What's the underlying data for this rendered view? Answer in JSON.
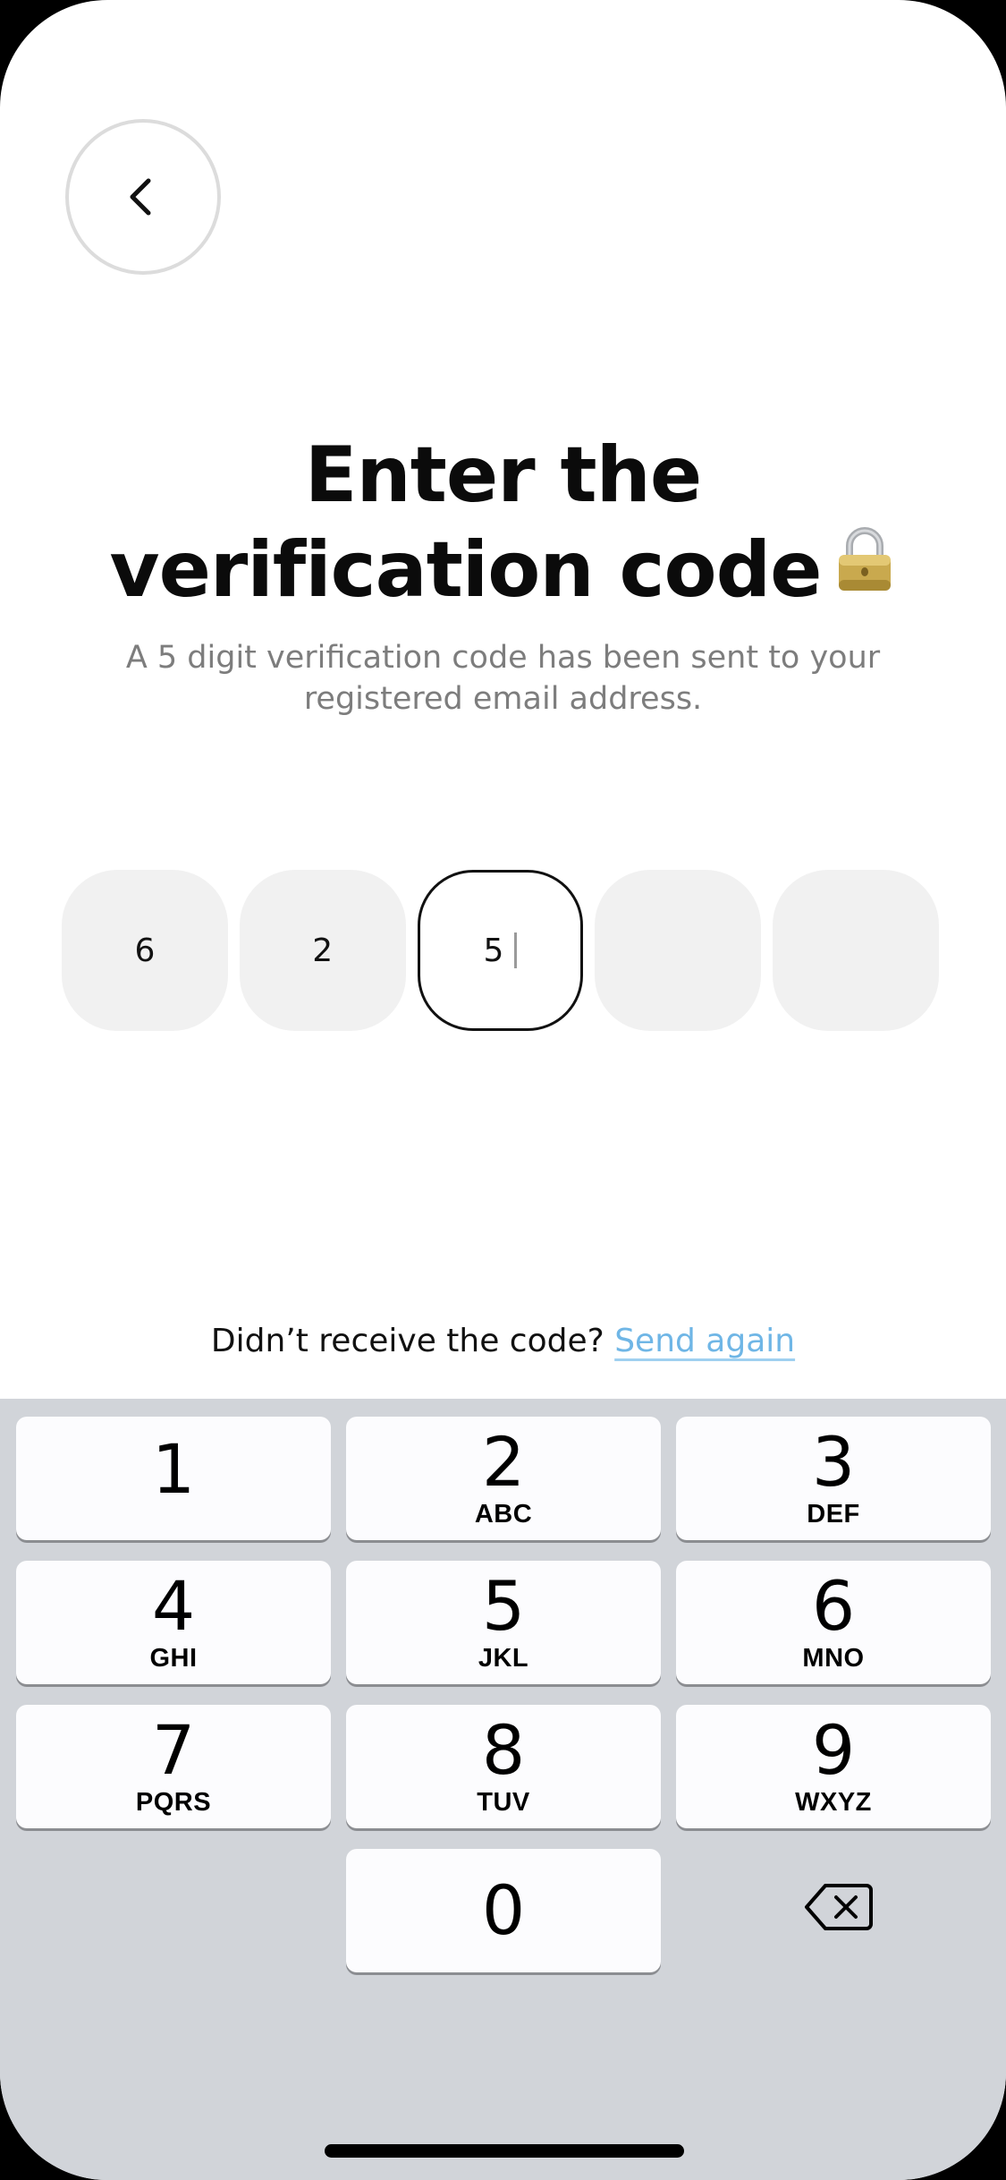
{
  "header": {
    "back_icon": "chevron-left-icon"
  },
  "title": {
    "line1": "Enter the",
    "line2": "verification code",
    "icon": "lock-icon"
  },
  "subtitle": "A 5 digit verification code has been sent to your registered email address.",
  "code": {
    "digits": [
      "6",
      "2",
      "5",
      "",
      ""
    ],
    "active_index": 2
  },
  "resend": {
    "prompt": "Didn’t receive the code?",
    "link": "Send again"
  },
  "keypad": {
    "keys": [
      {
        "digit": "1",
        "letters": ""
      },
      {
        "digit": "2",
        "letters": "ABC"
      },
      {
        "digit": "3",
        "letters": "DEF"
      },
      {
        "digit": "4",
        "letters": "GHI"
      },
      {
        "digit": "5",
        "letters": "JKL"
      },
      {
        "digit": "6",
        "letters": "MNO"
      },
      {
        "digit": "7",
        "letters": "PQRS"
      },
      {
        "digit": "8",
        "letters": "TUV"
      },
      {
        "digit": "9",
        "letters": "WXYZ"
      },
      {
        "digit": "0",
        "letters": ""
      }
    ],
    "delete_icon": "backspace-icon"
  },
  "colors": {
    "accent_link": "#6fb6e6",
    "box_fill": "#f1f1f1",
    "keyboard_bg": "#d1d4d9"
  }
}
